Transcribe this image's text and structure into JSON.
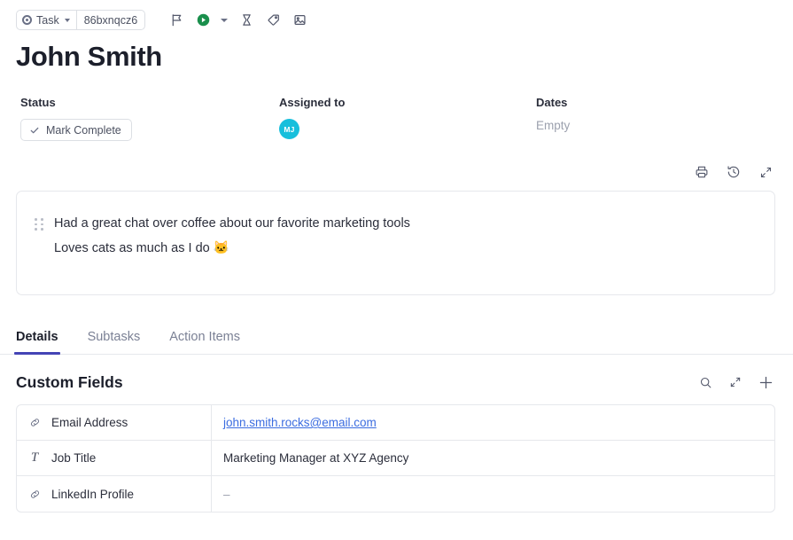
{
  "toolbar": {
    "type_pill": {
      "label": "Task",
      "icon": "task-status-dot-icon"
    },
    "id_pill": {
      "label": "86bxnqcz6"
    },
    "icons": [
      {
        "name": "flag-icon",
        "title": "Priority"
      },
      {
        "name": "play-circle-icon",
        "title": "Start timer"
      },
      {
        "name": "chevron-down-icon",
        "title": "Timer options"
      },
      {
        "name": "hourglass-icon",
        "title": "Time estimate"
      },
      {
        "name": "tag-icon",
        "title": "Tags"
      },
      {
        "name": "image-icon",
        "title": "Attachments"
      }
    ]
  },
  "task": {
    "title": "John Smith"
  },
  "meta": {
    "status": {
      "label": "Status",
      "button": "Mark Complete"
    },
    "assigned": {
      "label": "Assigned to",
      "avatar_initials": "MJ",
      "avatar_color": "#17bfdc"
    },
    "dates": {
      "label": "Dates",
      "value": "Empty"
    }
  },
  "actions": [
    {
      "name": "print-icon",
      "title": "Print"
    },
    {
      "name": "history-icon",
      "title": "History"
    },
    {
      "name": "expand-icon",
      "title": "Expand"
    }
  ],
  "description": {
    "drag_handle": "drag-handle-icon",
    "line1": "Had a great chat over coffee about our favorite marketing tools",
    "line2": "Loves cats as much as I do 🐱"
  },
  "tabs": [
    {
      "label": "Details",
      "active": true
    },
    {
      "label": "Subtasks",
      "active": false
    },
    {
      "label": "Action Items",
      "active": false
    }
  ],
  "custom_fields": {
    "heading": "Custom Fields",
    "actions": [
      {
        "name": "search-icon",
        "title": "Search fields"
      },
      {
        "name": "expand-icon",
        "title": "Expand"
      },
      {
        "name": "add-icon",
        "title": "Add field"
      }
    ],
    "rows": [
      {
        "icon": "link-field-icon",
        "name": "Email Address",
        "value": "john.smith.rocks@email.com",
        "is_link": true
      },
      {
        "icon": "text-field-icon",
        "name": "Job Title",
        "value": "Marketing Manager at XYZ Agency",
        "is_link": false
      },
      {
        "icon": "link-field-icon",
        "name": "LinkedIn Profile",
        "value": "–",
        "is_link": false
      }
    ]
  },
  "theme": {
    "accent": "#4444b5",
    "link": "#3b6ce0",
    "avatar": "#17bfdc",
    "play_green": "#1a8f4c",
    "border": "#e6e8ec",
    "muted": "#9ca1ae"
  }
}
